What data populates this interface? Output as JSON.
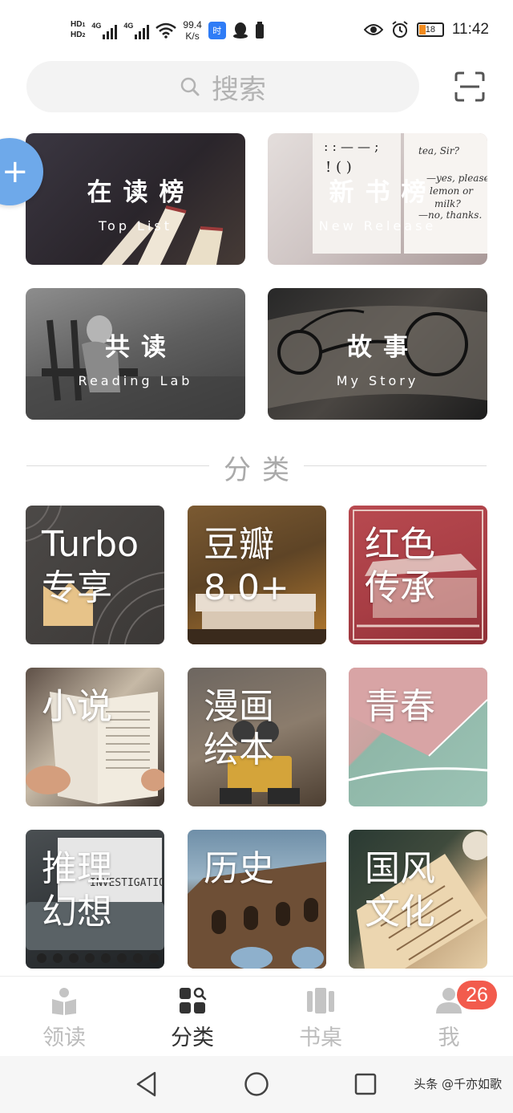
{
  "status_bar": {
    "hd1": "HD",
    "hd2": "HD",
    "sim1": "1",
    "sim2": "2",
    "net1": "4G",
    "net2": "4G",
    "speed_value": "99.4",
    "speed_unit": "K/s",
    "app_icon_label": "时",
    "battery": "18",
    "time": "11:42"
  },
  "search": {
    "placeholder": "搜索"
  },
  "feature_cards": [
    {
      "title": "在读榜",
      "subtitle": "Top List"
    },
    {
      "title": "新书榜",
      "subtitle": "New Release"
    },
    {
      "title": "共读",
      "subtitle": "Reading Lab"
    },
    {
      "title": "故事",
      "subtitle": "My Story"
    }
  ],
  "feature_decor": {
    "book_text_lines": [
      "tea, Sir?",
      "—yes, please!",
      "lemon or",
      "milk?",
      "—no, thanks."
    ],
    "book_punct": ": : — — ;",
    "book_punct2": "! ( )"
  },
  "section": {
    "title": "分类"
  },
  "categories": [
    {
      "name": "Turbo\n专享"
    },
    {
      "name": "豆瓣\n8.0+"
    },
    {
      "name": "红色\n传承"
    },
    {
      "name": "小说"
    },
    {
      "name": "漫画\n绘本"
    },
    {
      "name": "青春"
    },
    {
      "name": "推理\n幻想"
    },
    {
      "name": "历史"
    },
    {
      "name": "国风\n文化"
    }
  ],
  "category_decor": {
    "typewriter_text": "INVESTIGATIO"
  },
  "tabs": [
    {
      "label": "领读",
      "active": false
    },
    {
      "label": "分类",
      "active": true
    },
    {
      "label": "书桌",
      "active": false
    },
    {
      "label": "我",
      "active": false
    }
  ],
  "badge": "26",
  "watermark": "头条 @千亦如歌",
  "colors": {
    "accent_blue": "#6ea9ea",
    "badge_red": "#f25b4d",
    "battery_orange": "#f28b1e",
    "inactive_tab": "#bcbcbc"
  }
}
